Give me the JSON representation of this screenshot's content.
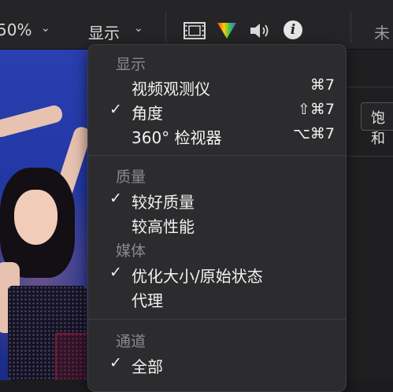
{
  "toolbar": {
    "zoom_value": "50%",
    "zoom_chevron": "⌄",
    "display_menu_label": "显示",
    "display_chevron": "⌄",
    "right_label": "未",
    "right_button_label": "饱和"
  },
  "icons": {
    "film": "film-strip-icon",
    "color": "color-triangle-icon",
    "speaker": "speaker-icon",
    "info": "info-icon",
    "info_glyph": "i"
  },
  "menu": {
    "sections": [
      {
        "header": "显示",
        "items": [
          {
            "label": "视频观测仪",
            "checked": false,
            "check": "",
            "shortcut": "⌘7"
          },
          {
            "label": "角度",
            "checked": true,
            "check": "✓",
            "shortcut": "⇧⌘7"
          },
          {
            "label": "360° 检视器",
            "checked": false,
            "check": "",
            "shortcut": "⌥⌘7"
          }
        ]
      },
      {
        "header": "质量",
        "items": [
          {
            "label": "较好质量",
            "checked": true,
            "check": "✓"
          },
          {
            "label": "较高性能",
            "checked": false,
            "check": ""
          }
        ]
      },
      {
        "header": "媒体",
        "items": [
          {
            "label": "优化大小/原始状态",
            "checked": true,
            "check": "✓"
          },
          {
            "label": "代理",
            "checked": false,
            "check": ""
          }
        ]
      },
      {
        "header": "通道",
        "items": [
          {
            "label": "全部",
            "checked": true,
            "check": "✓"
          }
        ]
      }
    ]
  },
  "colors": {
    "menu_bg": "#2c2c2e",
    "header_text": "#8a8a8c",
    "item_text": "#f2f2f2",
    "viewer_bg": "#2238a5"
  }
}
